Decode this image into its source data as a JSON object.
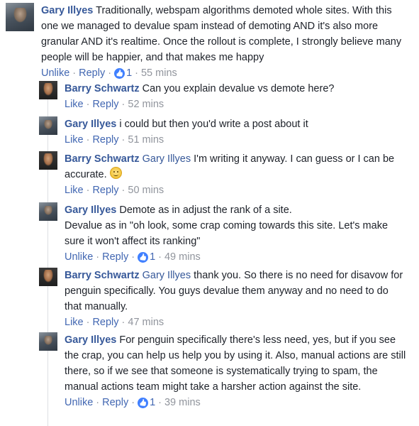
{
  "comments": [
    {
      "author": "Gary Illyes",
      "text": "Traditionally, webspam algorithms demoted whole sites. With this one we managed to devalue spam instead of demoting AND it's also more granular AND it's realtime. Once the rollout is complete, I strongly believe many people will be happier, and that makes me happy",
      "unlike_label": "Unlike",
      "reply_label": "Reply",
      "likes": "1",
      "time": "55 mins"
    }
  ],
  "replies": [
    {
      "author": "Barry Schwartz",
      "mention": "",
      "text": "Can you explain devalue vs demote here?",
      "like_label": "Like",
      "reply_label": "Reply",
      "time": "52 mins"
    },
    {
      "author": "Gary Illyes",
      "mention": "",
      "text": "i could but then you'd write a post about it",
      "like_label": "Like",
      "reply_label": "Reply",
      "time": "51 mins"
    },
    {
      "author": "Barry Schwartz",
      "mention": "Gary Illyes",
      "text": "I'm writing it anyway. I can guess or I can be accurate.",
      "like_label": "Like",
      "reply_label": "Reply",
      "time": "50 mins"
    },
    {
      "author": "Gary Illyes",
      "mention": "",
      "text": "Demote as in adjust the rank of a site.",
      "text2": "Devalue as in \"oh look, some crap coming towards this site. Let's make sure it won't affect its ranking\"",
      "unlike_label": "Unlike",
      "reply_label": "Reply",
      "likes": "1",
      "time": "49 mins"
    },
    {
      "author": "Barry Schwartz",
      "mention": "Gary Illyes",
      "text": "thank you. So there is no need for disavow for penguin specifically. You guys devalue them anyway and no need to do that manually.",
      "like_label": "Like",
      "reply_label": "Reply",
      "time": "47 mins"
    },
    {
      "author": "Gary Illyes",
      "mention": "",
      "text": "For penguin specifically there's less need, yes, but if you see the crap, you can help us help you by using it. Also, manual actions are still there, so if we see that someone is systematically trying to spam, the manual actions team might take a harsher action against the site.",
      "unlike_label": "Unlike",
      "reply_label": "Reply",
      "likes": "1",
      "time": "39 mins"
    }
  ],
  "icons": {
    "like": "thumbs-up-icon",
    "smiley": "smiley-emoji-icon"
  },
  "colors": {
    "link": "#365899",
    "action": "#4267b2",
    "meta": "#90949c",
    "like_badge": "#4080ff"
  }
}
